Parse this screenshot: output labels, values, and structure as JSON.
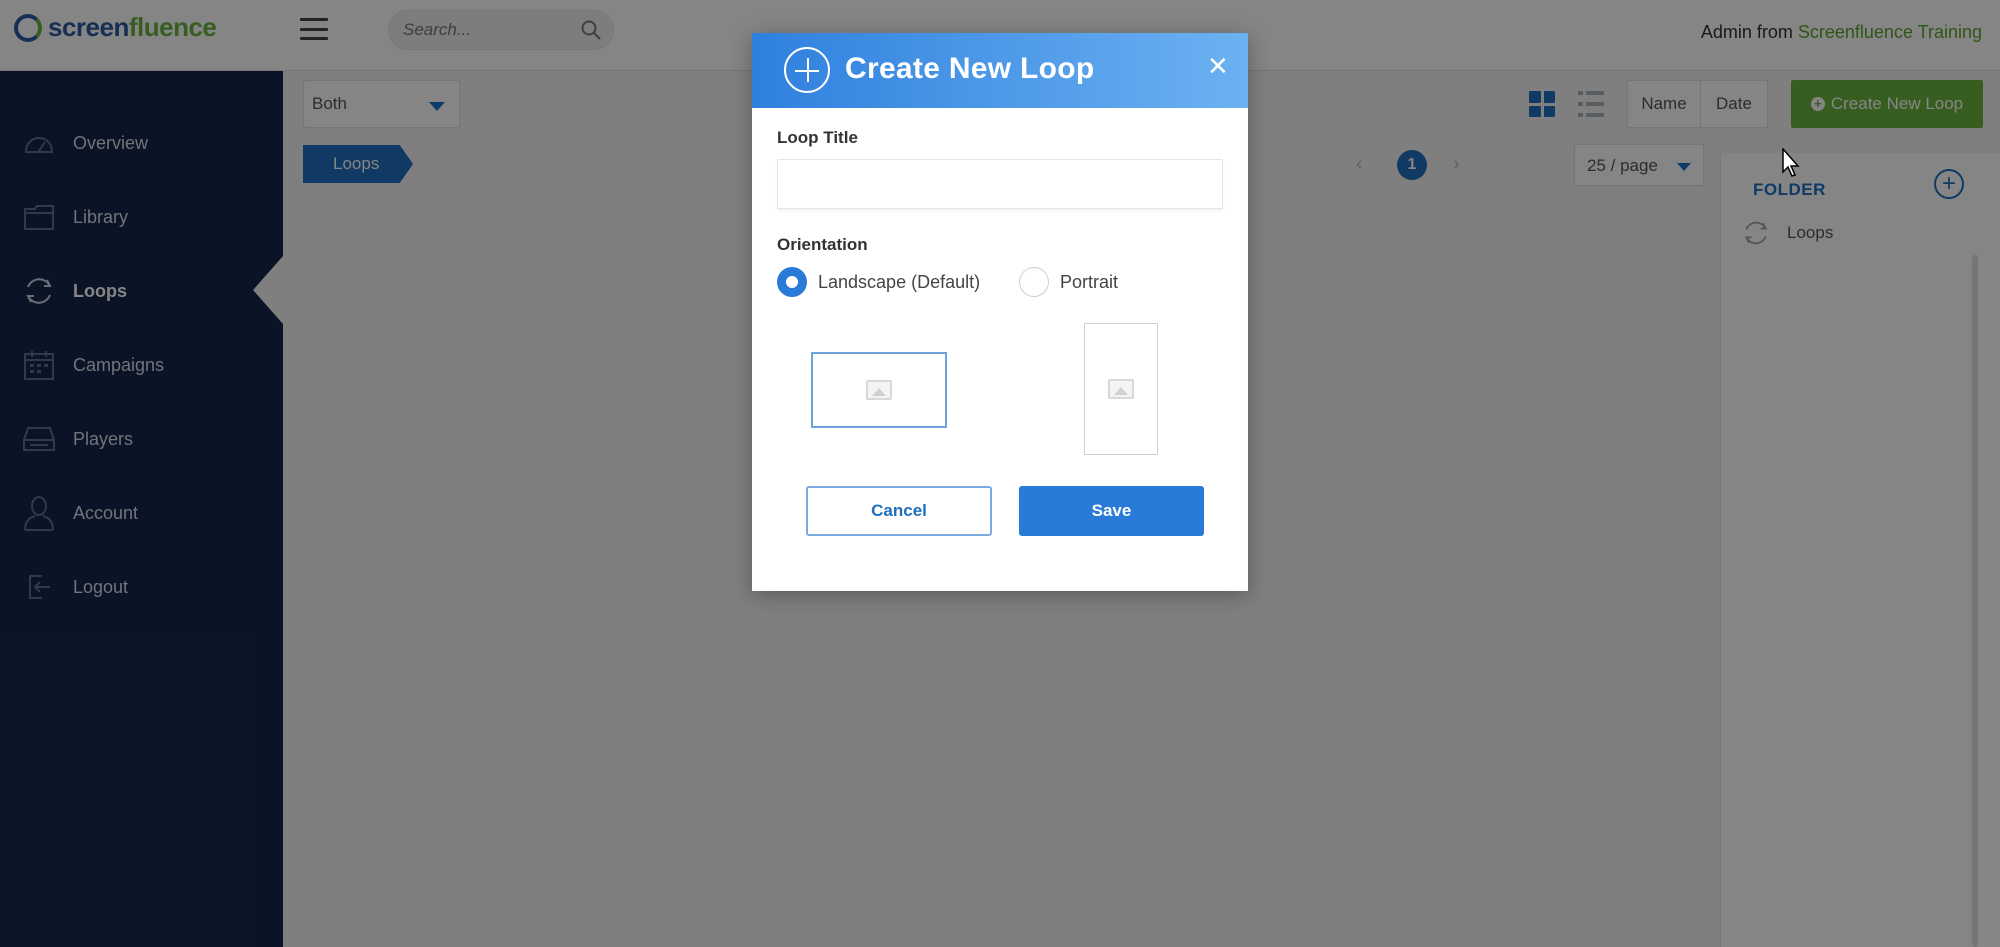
{
  "header": {
    "logo_text_prefix": "screen",
    "logo_text_suffix": "fluence",
    "search_placeholder": "Search...",
    "user_name": "Admin",
    "user_from": "from",
    "org_name": "Screenfluence Training"
  },
  "sidebar": {
    "items": [
      {
        "label": "Overview",
        "icon": "speedometer-icon"
      },
      {
        "label": "Library",
        "icon": "folder-icon"
      },
      {
        "label": "Loops",
        "icon": "loop-icon",
        "active": true
      },
      {
        "label": "Campaigns",
        "icon": "calendar-icon"
      },
      {
        "label": "Players",
        "icon": "player-device-icon"
      },
      {
        "label": "Account",
        "icon": "user-icon"
      },
      {
        "label": "Logout",
        "icon": "logout-icon"
      }
    ]
  },
  "toolbar": {
    "filter_value": "Both",
    "breadcrumb": "Loops",
    "sort_name_label": "Name",
    "sort_date_label": "Date",
    "create_label": "Create New Loop",
    "current_page": "1",
    "per_page": "25 / page"
  },
  "folder_panel": {
    "heading": "FOLDER",
    "items": [
      {
        "label": "Loops"
      }
    ]
  },
  "modal": {
    "title": "Create New Loop",
    "loop_title_label": "Loop Title",
    "loop_title_value": "",
    "orientation_label": "Orientation",
    "orientation_options": [
      {
        "label": "Landscape (Default)",
        "selected": true
      },
      {
        "label": "Portrait",
        "selected": false
      }
    ],
    "cancel_label": "Cancel",
    "save_label": "Save"
  },
  "colors": {
    "brand_blue": "#1f6fc0",
    "brand_green": "#6cb33f",
    "sidebar_bg": "#15284a",
    "modal_header_from": "#2f80de",
    "modal_header_to": "#6cb2f2"
  }
}
